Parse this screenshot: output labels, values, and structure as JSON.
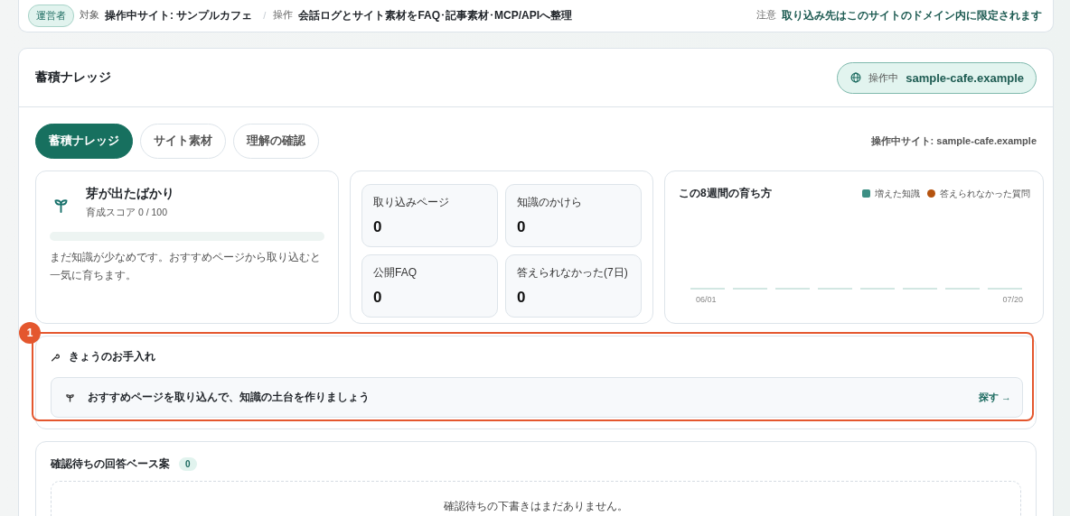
{
  "context_bar": {
    "role_badge": "運営者",
    "target_label": "対象",
    "target_value": "操作中サイト: サンプルカフェ",
    "separator": "/",
    "action_label": "操作",
    "action_value": "会話ログとサイト素材をFAQ･記事素材･MCP/APIへ整理",
    "note_label": "注意",
    "note_value": "取り込み先はこのサイトのドメイン内に限定されます"
  },
  "panel": {
    "title": "蓄積ナレッジ",
    "site_chip": {
      "label": "操作中",
      "value": "sample-cafe.example"
    }
  },
  "tabs": [
    {
      "label": "蓄積ナレッジ",
      "selected": true
    },
    {
      "label": "サイト素材",
      "selected": false
    },
    {
      "label": "理解の確認",
      "selected": false
    }
  ],
  "site_caption": "操作中サイト: sample-cafe.example",
  "growth": {
    "title": "芽が出たばかり",
    "score": "育成スコア 0 / 100",
    "level": 0,
    "message": "まだ知識が少なめです。おすすめページから取り込むと一気に育ちます。"
  },
  "stats": [
    {
      "label": "取り込みページ",
      "value": "0"
    },
    {
      "label": "知識のかけら",
      "value": "0"
    },
    {
      "label": "公開FAQ",
      "value": "0"
    },
    {
      "label": "答えられなかった(7日)",
      "value": "0"
    }
  ],
  "trend": {
    "title": "この8週間の育ち方",
    "legend": [
      {
        "label": "増えた知識",
        "color": "#3d8f84",
        "kind": "square"
      },
      {
        "label": "答えられなかった質問",
        "color": "#b5530f",
        "kind": "dot"
      }
    ],
    "x_labels": [
      "06/01",
      "07/20"
    ]
  },
  "maintenance": {
    "title": "きょうのお手入れ",
    "marker": "1",
    "tasks": [
      {
        "text": "おすすめページを取り込んで、知識の土台を作りましょう",
        "action": "探す →"
      }
    ]
  },
  "pending": {
    "title": "確認待ちの回答ベース案",
    "count": "0",
    "empty_text": "確認待ちの下書きはまだありません。"
  }
}
